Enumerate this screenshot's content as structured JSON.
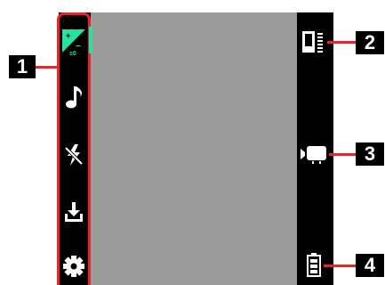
{
  "callouts": [
    {
      "number": "1",
      "target": "left-icon-bar"
    },
    {
      "number": "2",
      "target": "storage-indicator"
    },
    {
      "number": "3",
      "target": "video-mode-indicator"
    },
    {
      "number": "4",
      "target": "battery-indicator"
    }
  ],
  "left_bar": {
    "items": [
      {
        "icon": "exposure-compensation-icon",
        "value": "±0",
        "selected": true,
        "color": "#28e0a0"
      },
      {
        "icon": "music-note-icon"
      },
      {
        "icon": "flash-off-icon"
      },
      {
        "icon": "download-icon"
      },
      {
        "icon": "gear-icon"
      }
    ]
  },
  "right_bar": {
    "items": [
      {
        "icon": "storage-level-icon"
      },
      {
        "icon": "video-camera-icon"
      },
      {
        "icon": "battery-icon"
      }
    ]
  },
  "colors": {
    "accent": "#e8262a",
    "selected": "#28e0a0",
    "preview": "#9b9b9b"
  }
}
